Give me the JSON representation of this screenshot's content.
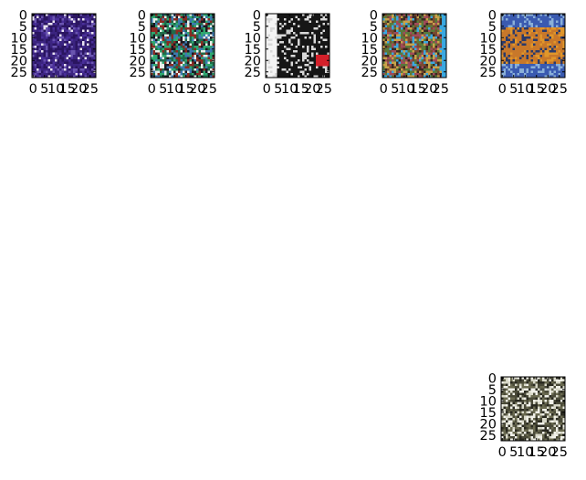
{
  "chart_data": [
    {
      "type": "heatmap",
      "description": "28x28 RGB image thumbnail",
      "image_shape": [
        28,
        28
      ],
      "xlim": [
        0,
        28
      ],
      "ylim": [
        28,
        0
      ],
      "xticks": [
        0,
        5,
        10,
        15,
        20,
        25
      ],
      "yticks": [
        0,
        5,
        10,
        15,
        20,
        25
      ],
      "xtick_labels": [
        "0",
        "5",
        "10",
        "15",
        "20",
        "25"
      ],
      "ytick_labels": [
        "0",
        "5",
        "10",
        "15",
        "20",
        "25"
      ],
      "palette": [
        "#2a1560",
        "#3b2480",
        "#4a2f9a",
        "#e8e2f0",
        "#6a55b0"
      ]
    },
    {
      "type": "heatmap",
      "description": "28x28 RGB image thumbnail",
      "image_shape": [
        28,
        28
      ],
      "xlim": [
        0,
        28
      ],
      "ylim": [
        28,
        0
      ],
      "xticks": [
        0,
        5,
        10,
        15,
        20,
        25
      ],
      "yticks": [
        0,
        5,
        10,
        15,
        20,
        25
      ],
      "xtick_labels": [
        "0",
        "5",
        "10",
        "15",
        "20",
        "25"
      ],
      "ytick_labels": [
        "0",
        "5",
        "10",
        "15",
        "20",
        "25"
      ],
      "palette": [
        "#1f6b4a",
        "#2fa870",
        "#e9efe9",
        "#1a1a22",
        "#8a2a22",
        "#3d7ab0"
      ]
    },
    {
      "type": "heatmap",
      "description": "28x28 RGB image thumbnail",
      "image_shape": [
        28,
        28
      ],
      "xlim": [
        0,
        28
      ],
      "ylim": [
        28,
        0
      ],
      "xticks": [
        0,
        5,
        10,
        15,
        20,
        25
      ],
      "yticks": [
        0,
        5,
        10,
        15,
        20,
        25
      ],
      "xtick_labels": [
        "0",
        "5",
        "10",
        "15",
        "20",
        "25"
      ],
      "ytick_labels": [
        "0",
        "5",
        "10",
        "15",
        "20",
        "25"
      ],
      "palette": [
        "#f4f4f4",
        "#161616",
        "#202020",
        "#d8d8d8",
        "#d4202a"
      ]
    },
    {
      "type": "heatmap",
      "description": "28x28 RGB image thumbnail",
      "image_shape": [
        28,
        28
      ],
      "xlim": [
        0,
        28
      ],
      "ylim": [
        28,
        0
      ],
      "xticks": [
        0,
        5,
        10,
        15,
        20,
        25
      ],
      "yticks": [
        0,
        5,
        10,
        15,
        20,
        25
      ],
      "xtick_labels": [
        "0",
        "5",
        "10",
        "15",
        "20",
        "25"
      ],
      "ytick_labels": [
        "0",
        "5",
        "10",
        "15",
        "20",
        "25"
      ],
      "palette": [
        "#3a2a22",
        "#7a4a30",
        "#c9a24a",
        "#5a7a3a",
        "#a04a5a",
        "#3aa8e0"
      ]
    },
    {
      "type": "heatmap",
      "description": "28x28 RGB image thumbnail",
      "image_shape": [
        28,
        28
      ],
      "xlim": [
        0,
        28
      ],
      "ylim": [
        28,
        0
      ],
      "xticks": [
        0,
        5,
        10,
        15,
        20,
        25
      ],
      "yticks": [
        0,
        5,
        10,
        15,
        20,
        25
      ],
      "xtick_labels": [
        "0",
        "5",
        "10",
        "15",
        "20",
        "25"
      ],
      "ytick_labels": [
        "0",
        "5",
        "10",
        "15",
        "20",
        "25"
      ],
      "palette": [
        "#3a5ab0",
        "#c8782a",
        "#e0962a",
        "#2a3a6a",
        "#8ab0d8"
      ]
    },
    {
      "type": "heatmap",
      "description": "28x28 RGB image thumbnail",
      "image_shape": [
        28,
        28
      ],
      "xlim": [
        0,
        28
      ],
      "ylim": [
        28,
        0
      ],
      "xticks": [
        0,
        5,
        10,
        15,
        20,
        25
      ],
      "yticks": [
        0,
        5,
        10,
        15,
        20,
        25
      ],
      "xtick_labels": [
        "0",
        "5",
        "10",
        "15",
        "20",
        "25"
      ],
      "ytick_labels": [
        "0",
        "5",
        "10",
        "15",
        "20",
        "25"
      ],
      "palette": [
        "#2a2a20",
        "#4a4a38",
        "#d8d8c8",
        "#6a6a50",
        "#f0f0e8"
      ]
    }
  ]
}
